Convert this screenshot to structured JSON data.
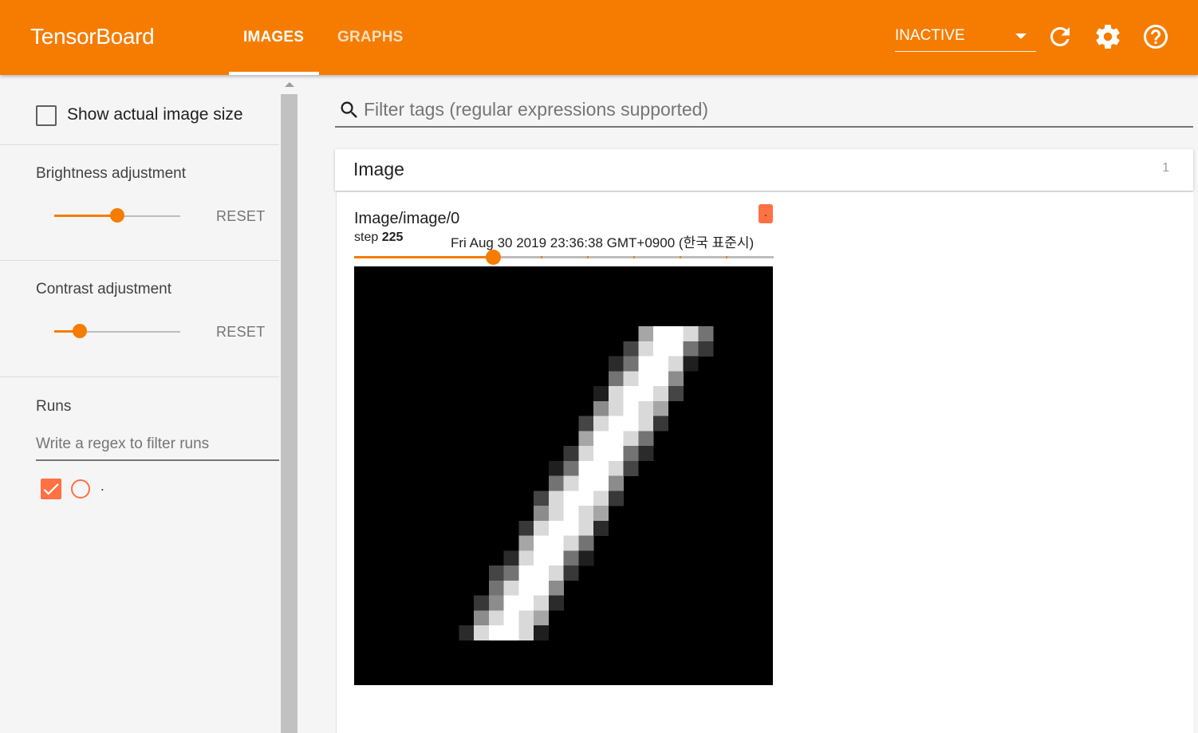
{
  "header": {
    "brand": "TensorBoard",
    "tabs": [
      {
        "label": "IMAGES",
        "active": true
      },
      {
        "label": "GRAPHS",
        "active": false
      }
    ],
    "status": "INACTIVE",
    "icons": [
      "refresh-icon",
      "settings-icon",
      "help-icon"
    ],
    "accent": "#f57c00"
  },
  "sidebar": {
    "show_actual_size_label": "Show actual image size",
    "show_actual_size_checked": false,
    "brightness": {
      "label": "Brightness adjustment",
      "reset_label": "RESET",
      "level": 0.5
    },
    "contrast": {
      "label": "Contrast adjustment",
      "reset_label": "RESET",
      "level": 0.2
    },
    "runs": {
      "heading": "Runs",
      "filter_placeholder": "Write a regex to filter runs",
      "items": [
        {
          "name": ".",
          "checked": true,
          "color": "#ff7043"
        }
      ]
    }
  },
  "main": {
    "search_placeholder": "Filter tags (regular expressions supported)",
    "card": {
      "title": "Image",
      "count": "1",
      "image": {
        "tag": "Image/image/0",
        "run_badge": ".",
        "step_label": "step",
        "step": "225",
        "timestamp": "Fri Aug 30 2019 23:36:38 GMT+0900 (한국 표준시)",
        "step_slider_level": 0.33,
        "content": "handwritten digit 1 (28x28 grayscale)"
      }
    }
  }
}
